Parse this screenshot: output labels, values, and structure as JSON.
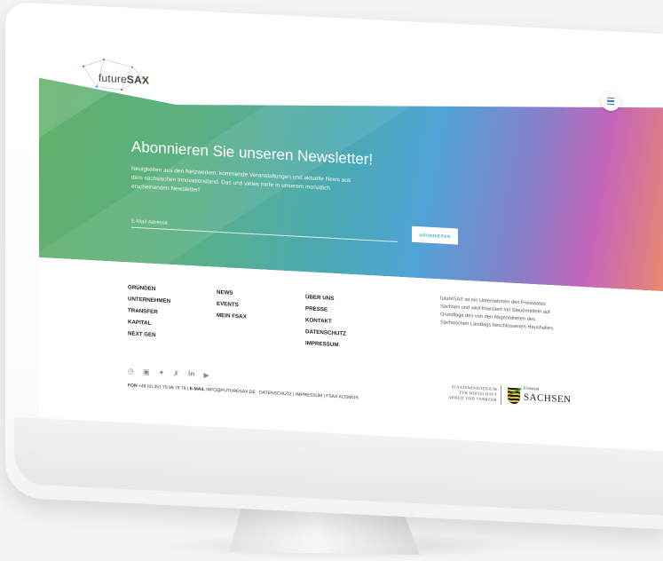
{
  "brand": {
    "logo_pre": "future",
    "logo_bold": "SAX"
  },
  "newsletter": {
    "title": "Abonnieren Sie unseren Newsletter!",
    "text": "Neuigkeiten aus den Netzwerken, kommende Veranstaltungen und aktuelle News aus dem sächsischen Innovationsland. Das und vieles mehr in unserem monatlich erscheinenden Newsletter!",
    "email_placeholder": "E-Mail-Adresse",
    "button_label": "ABONNIEREN"
  },
  "footer": {
    "col1": [
      "GRÜNDEN",
      "UNTERNEHMEN",
      "TRANSFER",
      "KAPITAL",
      "NEXT GEN"
    ],
    "col2": [
      "NEWS",
      "EVENTS",
      "MEIN FSAX"
    ],
    "col3": [
      "ÜBER UNS",
      "PRESSE",
      "KONTAKT",
      "DATENSCHUTZ",
      "IMPRESSUM"
    ],
    "about": "futureSAX ist ein Unternehmen des Freistaates Sachsen und wird finanziert mit Steuermitteln auf Grundlage des von den Abgeordneten des Sächsischen Landtags beschlossenen Haushaltes.",
    "social_icons": [
      "instagram-icon",
      "facebook-icon",
      "twitter-icon",
      "xing-icon",
      "linkedin-icon",
      "youtube-icon"
    ],
    "contact": {
      "fon_label": "FON",
      "fon": "+49 (0) 351 79 99 79 79 |",
      "email_label": "E-MAIL",
      "email": "INFO@FUTURESAX.DE",
      "links": "DATENSCHUTZ | IMPRESSUM | FSAX KOSMOS"
    },
    "ministry": [
      "STAATSMINISTERIUM",
      "FÜR WIRTSCHAFT",
      "ARBEIT UND VERKEHR"
    ],
    "state_small": "Freistaat",
    "state_large": "SACHSEN"
  }
}
